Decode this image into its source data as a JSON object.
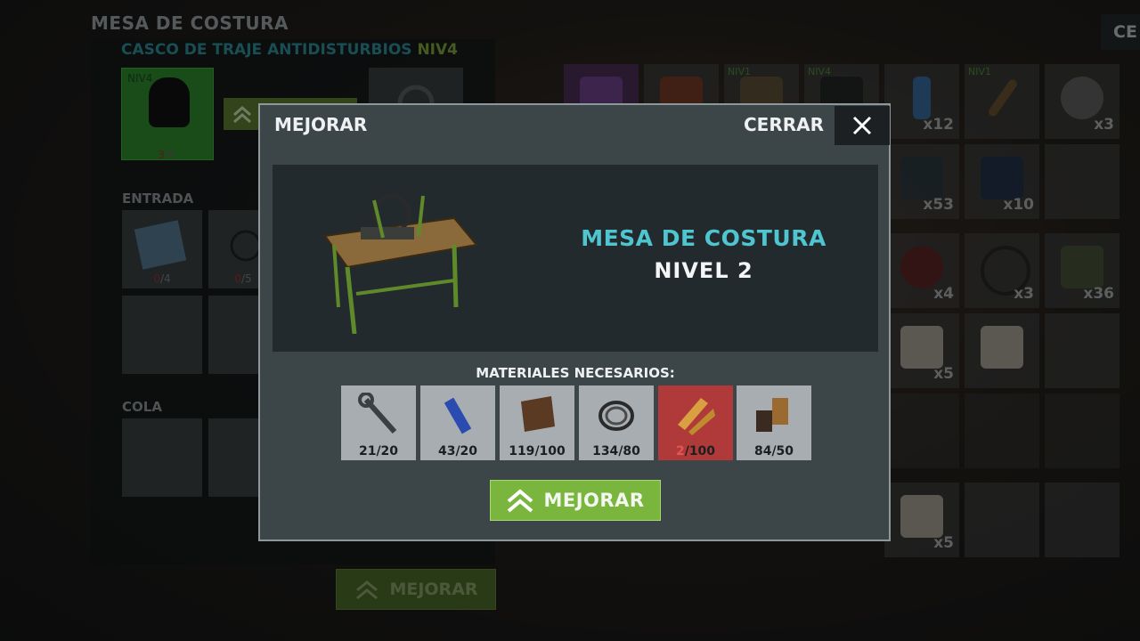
{
  "colors": {
    "accent_teal": "#4fc5d0",
    "upgrade_green": "#7ab53e",
    "missing_red": "#b03a3a",
    "item_slot_green": "#2e8a2f"
  },
  "station": {
    "title": "MESA DE COSTURA",
    "item_name": "CASCO DE TRAJE ANTIDISTURBIOS",
    "item_level": "NIV4",
    "slot_level": "NIV4",
    "slot_count_have": "3",
    "slot_count_need": "/8",
    "input_label": "ENTRADA",
    "inputs": [
      {
        "have": "0",
        "need": "/4",
        "icon": "blue-cloth-icon"
      },
      {
        "have": "0",
        "need": "/5",
        "icon": "wire-coil-icon"
      }
    ],
    "queue_label": "COLA",
    "bottom_button": "MEJORAR"
  },
  "top_right_button": "CE",
  "inventory": [
    {
      "icon": "purple-star-icon",
      "qty": "",
      "lvl": ""
    },
    {
      "icon": "leather-icon",
      "qty": "",
      "lvl": ""
    },
    {
      "icon": "backpack-icon",
      "qty": "",
      "lvl": "NIV1"
    },
    {
      "icon": "vest-icon",
      "qty": "",
      "lvl": "NIV4"
    },
    {
      "icon": "water-bottle-icon",
      "qty": "x12",
      "lvl": ""
    },
    {
      "icon": "spiked-bat-icon",
      "qty": "",
      "lvl": "NIV1"
    },
    {
      "icon": "saw-blade-icon",
      "qty": "x3",
      "lvl": ""
    },
    {
      "icon": "electronics-icon",
      "qty": "x53",
      "lvl": ""
    },
    {
      "icon": "battery-icon",
      "qty": "x10",
      "lvl": ""
    },
    {
      "icon": "cables-icon",
      "qty": "x4",
      "lvl": ""
    },
    {
      "icon": "rubber-bands-icon",
      "qty": "x3",
      "lvl": ""
    },
    {
      "icon": "tools-icon",
      "qty": "x36",
      "lvl": ""
    },
    {
      "icon": "bandage-roll-icon",
      "qty": "x5",
      "lvl": ""
    },
    {
      "icon": "bandage-roll-icon",
      "qty": "",
      "lvl": ""
    },
    {
      "icon": "bandage-roll-icon",
      "qty": "x5",
      "lvl": ""
    }
  ],
  "modal": {
    "title": "MEJORAR",
    "close_label": "CERRAR",
    "preview": {
      "name": "MESA DE COSTURA",
      "level": "NIVEL 2",
      "icon": "sewing-table-icon"
    },
    "materials_label": "MATERIALES NECESARIOS:",
    "materials": [
      {
        "icon": "wrench-icon",
        "have": "21",
        "need": "/20",
        "short": false
      },
      {
        "icon": "spray-can-icon",
        "have": "43",
        "need": "/20",
        "short": false
      },
      {
        "icon": "leather-icon",
        "have": "119",
        "need": "/100",
        "short": false
      },
      {
        "icon": "wire-coil-icon",
        "have": "134",
        "need": "/80",
        "short": false
      },
      {
        "icon": "wood-planks-icon",
        "have": "2",
        "need": "/100",
        "short": true
      },
      {
        "icon": "thread-spool-icon",
        "have": "84",
        "need": "/50",
        "short": false
      }
    ],
    "upgrade_button": "MEJORAR"
  }
}
